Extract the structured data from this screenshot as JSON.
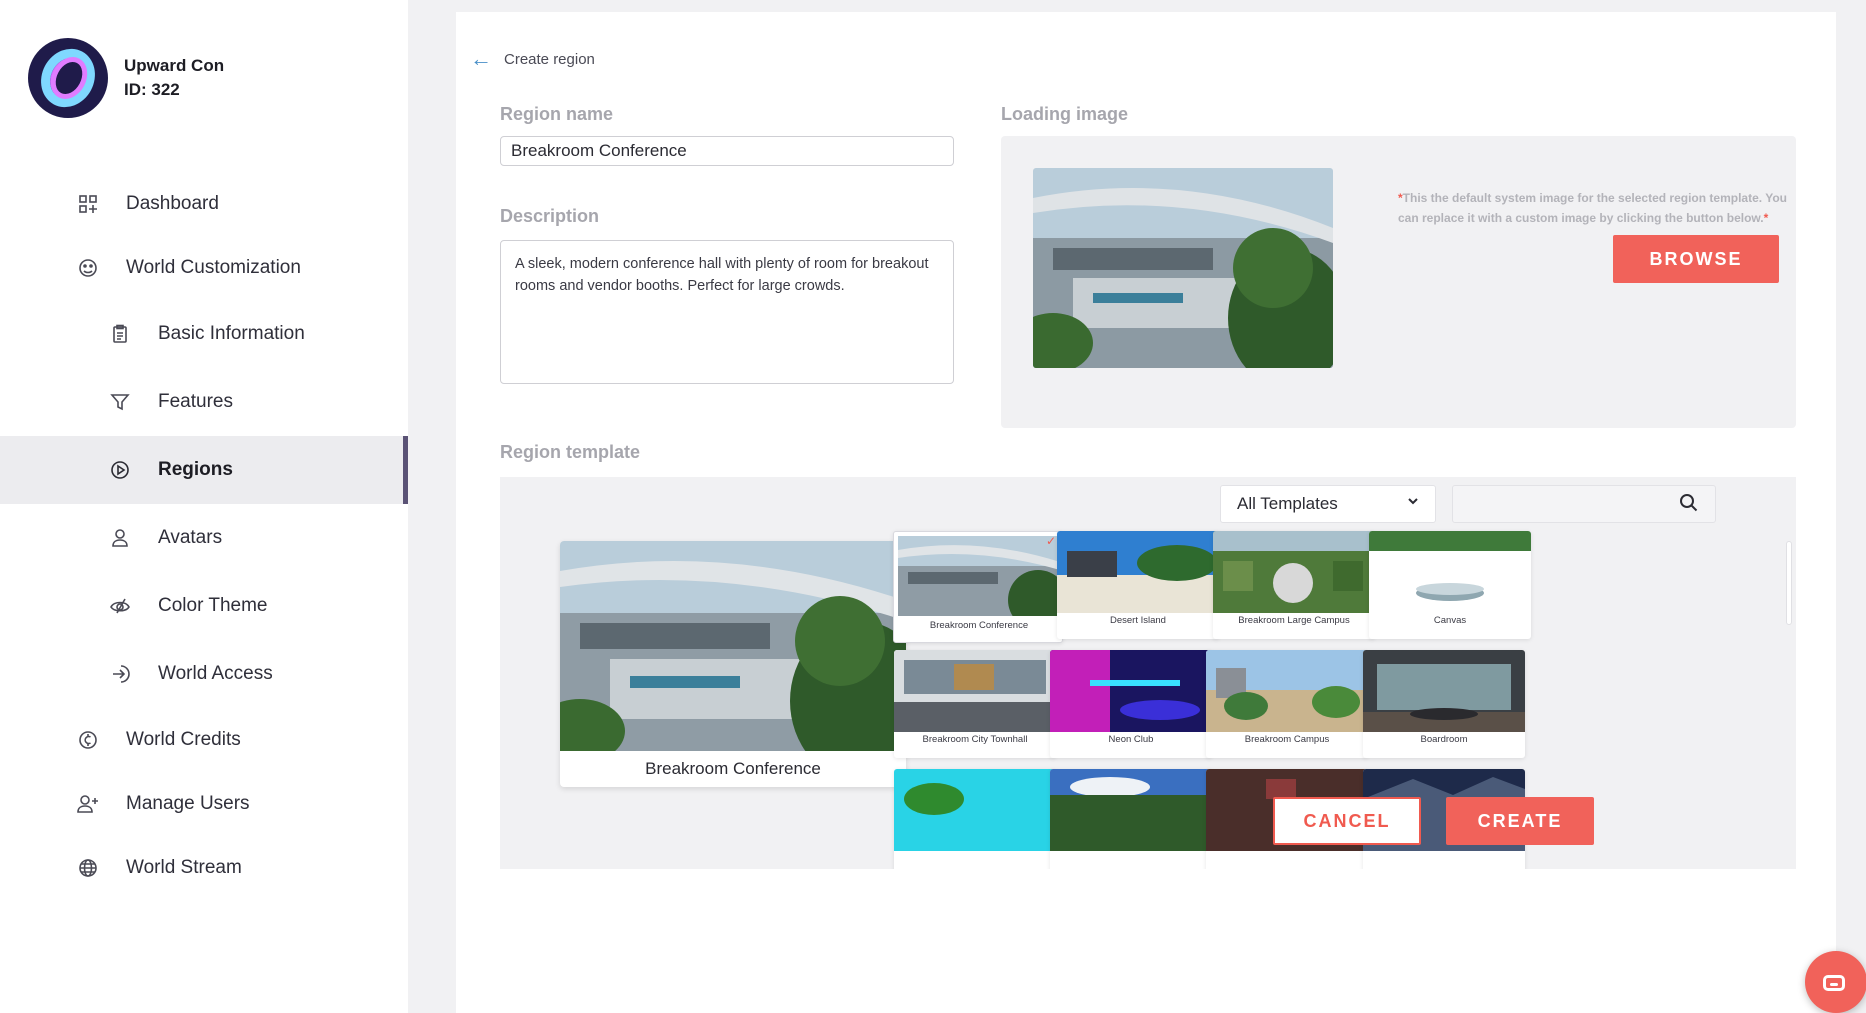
{
  "account": {
    "name": "Upward Con",
    "id_label": "ID: 322"
  },
  "nav": {
    "dashboard": "Dashboard",
    "world_customization": "World Customization",
    "basic_information": "Basic Information",
    "features": "Features",
    "regions": "Regions",
    "avatars": "Avatars",
    "color_theme": "Color Theme",
    "world_access": "World Access",
    "world_credits": "World Credits",
    "manage_users": "Manage Users",
    "world_stream": "World Stream"
  },
  "header": {
    "back_label": "Create region"
  },
  "form": {
    "region_name_label": "Region name",
    "region_name_value": "Breakroom Conference",
    "description_label": "Description",
    "description_value": "A sleek, modern conference hall with plenty of room for breakout rooms and vendor booths. Perfect for large crowds.",
    "loading_image_label": "Loading image",
    "loading_note": "This the default system image for the selected region template. You can replace it with a custom image by clicking the button below.",
    "loading_note_star": "*",
    "browse_label": "BROWSE",
    "region_template_label": "Region template"
  },
  "templates": {
    "filter_selected": "All Templates",
    "search_value": "",
    "preview_caption": "Breakroom Conference",
    "items": [
      {
        "name": "Breakroom Conference",
        "selected": true
      },
      {
        "name": "Desert Island"
      },
      {
        "name": "Breakroom Large Campus"
      },
      {
        "name": "Canvas"
      },
      {
        "name": "Breakroom City Townhall"
      },
      {
        "name": "Neon Club"
      },
      {
        "name": "Breakroom Campus"
      },
      {
        "name": "Boardroom"
      }
    ]
  },
  "actions": {
    "cancel_label": "CANCEL",
    "create_label": "CREATE"
  },
  "colors": {
    "accent": "#f1625a",
    "active_bar": "#5a5275",
    "link_arrow": "#4a90c8"
  },
  "icons": [
    "dashboard-icon",
    "world-customization-icon",
    "clipboard-icon",
    "funnel-icon",
    "regions-icon",
    "avatar-icon",
    "color-theme-icon",
    "world-access-icon",
    "credits-icon",
    "manage-users-icon",
    "globe-icon",
    "search-icon",
    "chevron-down-icon",
    "back-arrow-icon",
    "check-icon",
    "chat-icon"
  ]
}
